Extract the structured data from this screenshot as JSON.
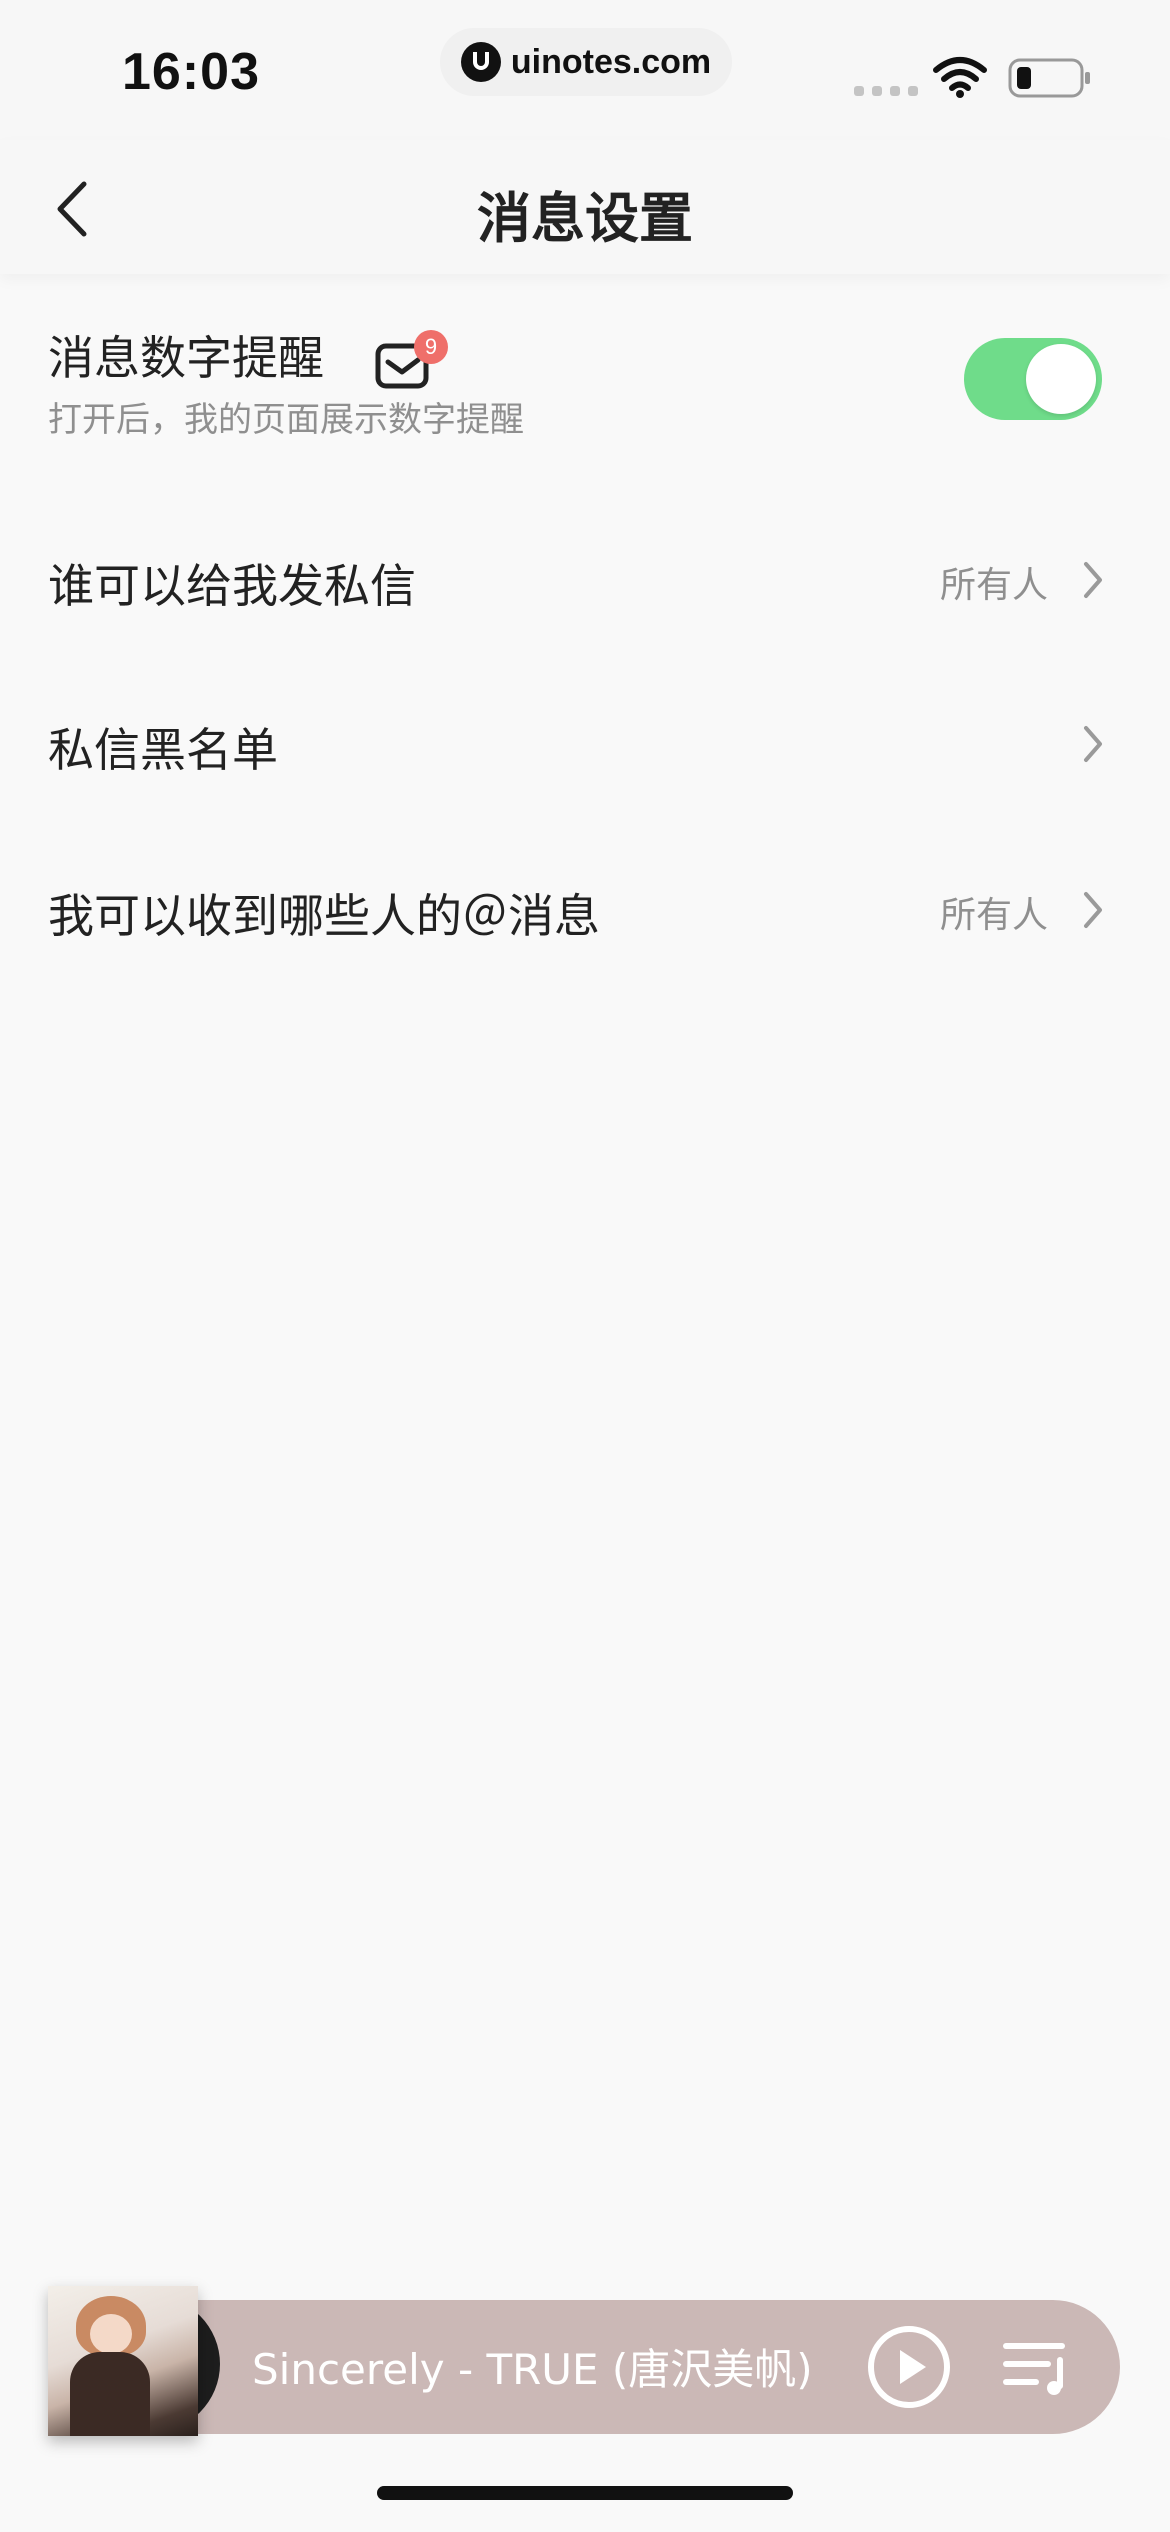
{
  "status_bar": {
    "time": "16:03",
    "url": "uinotes.com",
    "icons": [
      "signal-icon",
      "wifi-icon",
      "battery-icon"
    ]
  },
  "nav": {
    "title": "消息设置",
    "back_icon": "chevron-left-icon"
  },
  "settings": {
    "badge_reminder": {
      "title": "消息数字提醒",
      "subtitle": "打开后，我的页面展示数字提醒",
      "badge_count": "9",
      "toggle_on": true,
      "icon": "mail-badge-icon"
    },
    "who_can_message": {
      "title": "谁可以给我发私信",
      "value": "所有人"
    },
    "blacklist": {
      "title": "私信黑名单"
    },
    "who_can_mention": {
      "title": "我可以收到哪些人的＠消息",
      "value": "所有人"
    }
  },
  "player": {
    "song": "Sincerely - TRUE (唐沢美帆)",
    "icons": [
      "album-cover",
      "play-icon",
      "playlist-icon"
    ]
  },
  "colors": {
    "toggle_on": "#6fdc8a",
    "badge": "#ef6f6a",
    "player_bg": "#cbb8b6",
    "background": "#f9f9f9"
  }
}
